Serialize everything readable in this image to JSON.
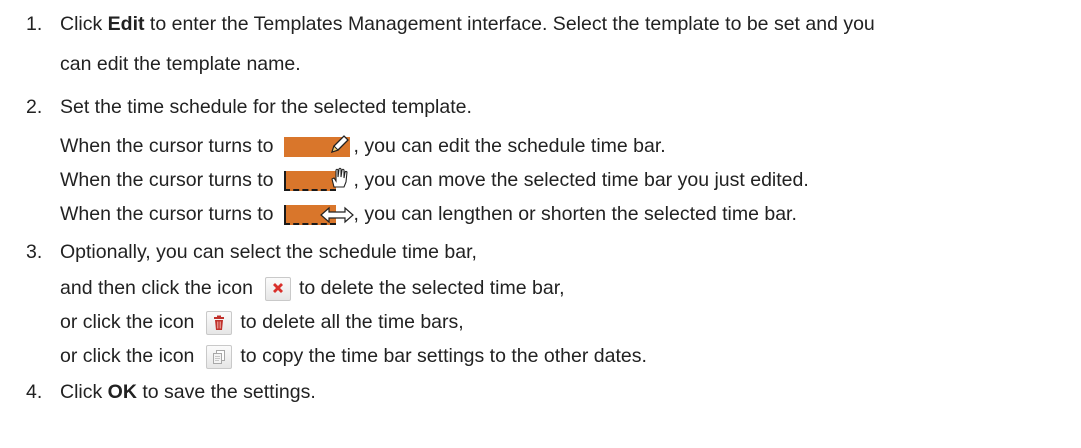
{
  "steps": [
    {
      "num": "1.",
      "pre": "Click ",
      "bold": "Edit",
      "post": " to enter the Templates Management interface. Select the template to be set and you",
      "cont": "can edit the template name."
    },
    {
      "num": "2.",
      "text": "Set the time schedule for the selected template.",
      "cursors": [
        {
          "pre": "When the cursor turns to",
          "icon": "pencil-cursor-icon",
          "post": ", you can edit the schedule time bar."
        },
        {
          "pre": "When the cursor turns to",
          "icon": "hand-cursor-icon",
          "post": ", you can move the selected time bar you just edited."
        },
        {
          "pre": "When the cursor turns to",
          "icon": "resize-cursor-icon",
          "post": ", you can lengthen or shorten the selected time bar."
        }
      ]
    },
    {
      "num": "3.",
      "text": "Optionally, you can select the schedule time bar,",
      "actions": [
        {
          "pre": "and then click the icon",
          "icon": "delete-x-icon",
          "post": "to delete the selected time bar,"
        },
        {
          "pre": "or click the icon",
          "icon": "trash-icon",
          "post": "to delete all the time bars,"
        },
        {
          "pre": "or click the icon",
          "icon": "copy-icon",
          "post": "to copy the time bar settings to the other dates."
        }
      ]
    },
    {
      "num": "4.",
      "pre": "Click ",
      "bold": "OK",
      "post": " to save the settings."
    }
  ],
  "colors": {
    "bar": "#d9762b",
    "delete": "#d9302b"
  }
}
